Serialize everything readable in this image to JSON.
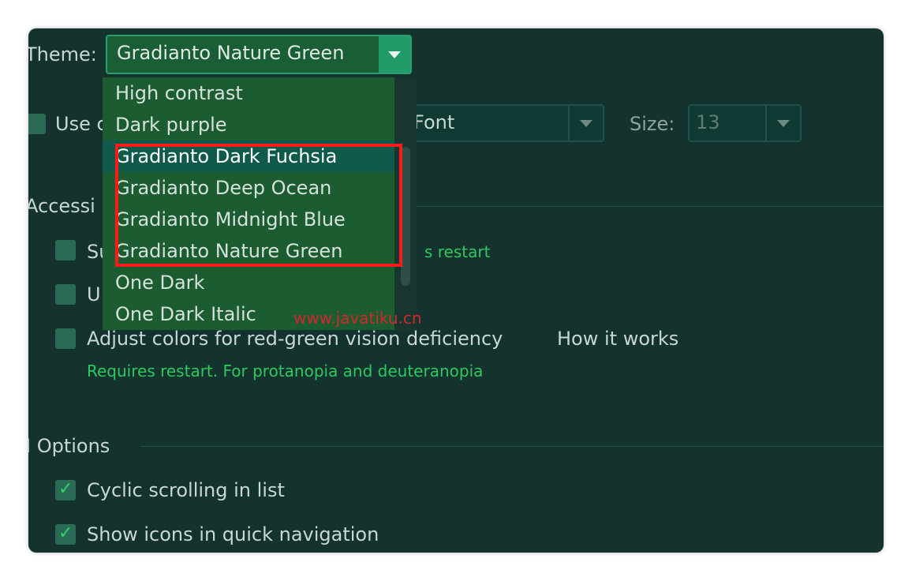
{
  "appearance": {
    "theme_label": "Theme:",
    "theme_value": "Gradianto Nature Green",
    "use_custom_font_label_visible": "Use c",
    "font_value_visible": "Font",
    "size_label": "Size:",
    "size_value": "13"
  },
  "theme_dropdown": {
    "items": [
      "High contrast",
      "Dark purple",
      "Gradianto Dark Fuchsia",
      "Gradianto Deep Ocean",
      "Gradianto Midnight Blue",
      "Gradianto Nature Green",
      "One Dark",
      "One Dark Italic"
    ],
    "selected_index": 2
  },
  "accessibility": {
    "section_label_visible": "Accessi",
    "option1_visible": "Su",
    "option1_note_visible": "s restart",
    "option2_visible": "U",
    "option3_label": "Adjust colors for red-green vision deficiency",
    "option3_link": "How it works",
    "option3_note": "Requires restart. For protanopia and deuteranopia"
  },
  "ui_options": {
    "section_label_visible": "I Options",
    "cyclic_scrolling": "Cyclic scrolling in list",
    "show_icons": "Show icons in quick navigation"
  },
  "watermark": "www.javatiku.cn",
  "colors": {
    "window_bg": "#14332f",
    "accent_green": "#2ec95e",
    "highlight_red": "#ff1a1a",
    "popup_bg": "#1b5d31"
  }
}
